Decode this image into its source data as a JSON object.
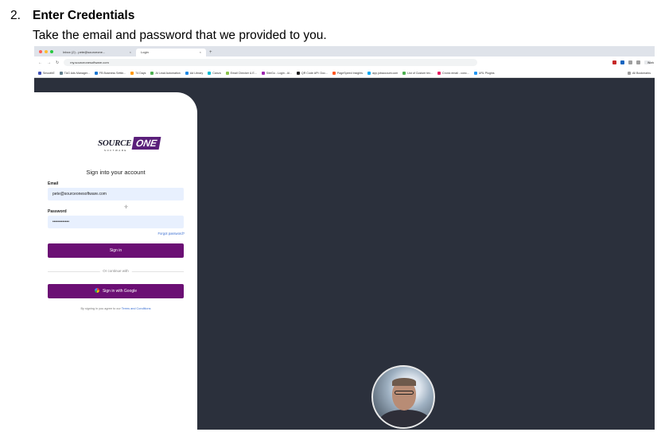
{
  "doc": {
    "step_number": "2.",
    "step_title": "Enter Credentials",
    "step_description": "Take the email and password that we provided to you."
  },
  "browser": {
    "tabs": [
      {
        "label": "Inbox (2) - pete@sourceone..."
      },
      {
        "label": "Login"
      }
    ],
    "url": "my.sourceonesoftware.com",
    "profile": "Work",
    "bookmarks": [
      "SmoothE",
      "TAG Ads Manager...",
      "FB Business Settin...",
      "74 Days",
      "AI Lead Automation",
      "Ad Library",
      "Canva",
      "Email Checker & E...",
      "SiteGo - Login - Al...",
      "QR Code API: Doc...",
      "PageSpeed Insights",
      "app.jobaccount.com",
      "List of Custom tex...",
      "Cronic email - conc...",
      "URL Plugins"
    ],
    "all_bookmarks": "All Bookmarks"
  },
  "login": {
    "logo_main": "SOURCE",
    "logo_accent": "ONE",
    "logo_sub": "SOFTWARE",
    "heading": "Sign into your account",
    "email_label": "Email",
    "email_value": "pete@sourceonesoftware.com",
    "password_label": "Password",
    "password_value": "••••••••••••",
    "forgot": "Forgot password?",
    "signin_button": "Sign in",
    "divider_text": "Or continue with",
    "google_button": "Sign in with Google",
    "terms_prefix": "By signing in you agree to our",
    "terms_link": "Terms and Conditions"
  },
  "colors": {
    "brand_purple": "#6b0f74",
    "page_background": "#2b303c",
    "link_blue": "#3b6fd1"
  }
}
